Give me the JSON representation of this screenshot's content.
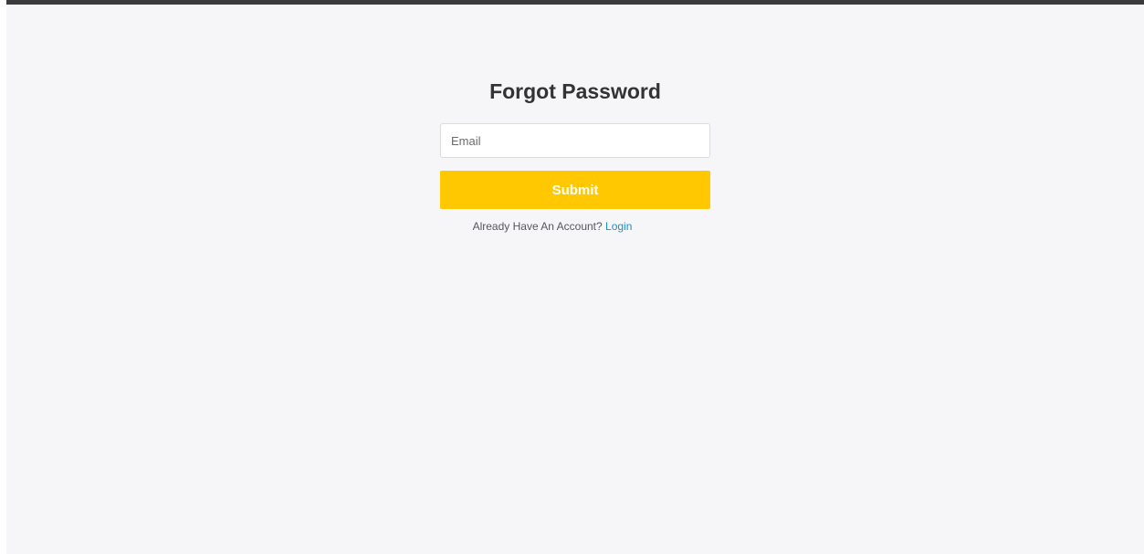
{
  "form": {
    "title": "Forgot Password",
    "email_placeholder": "Email",
    "email_value": "",
    "submit_label": "Submit",
    "account_prompt": "Already Have An Account?",
    "login_label": "Login"
  },
  "colors": {
    "top_bar": "#3a3a3d",
    "page_background": "#f6f6f8",
    "submit_button": "#ffc800",
    "link": "#1e90c8"
  }
}
